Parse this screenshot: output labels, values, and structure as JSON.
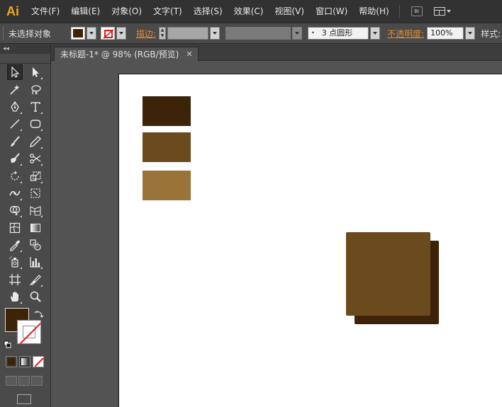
{
  "app": {
    "logo": "Ai"
  },
  "menu": [
    "文件(F)",
    "编辑(E)",
    "对象(O)",
    "文字(T)",
    "选择(S)",
    "效果(C)",
    "视图(V)",
    "窗口(W)",
    "帮助(H)"
  ],
  "bridge_label": "Br",
  "control_bar": {
    "selection_label": "未选择对象",
    "stroke_label": "描边:",
    "brush_value": "3 点圆形",
    "opacity_label": "不透明度:",
    "opacity_value": "100%",
    "style_label": "样式:",
    "fill_color": "#3d2408"
  },
  "document": {
    "tab_title": "未标题-1* @ 98% (RGB/预览)",
    "close": "✕"
  },
  "toolbox": {
    "collapse": "◂◂",
    "fill_color": "#3d2408"
  },
  "colors": {
    "dark_brown": "#3d2408",
    "medium_brown": "#6b4a1e",
    "light_brown": "#9a7338",
    "shadow_brown": "#3d2408",
    "front_brown": "#6b4a1e"
  }
}
